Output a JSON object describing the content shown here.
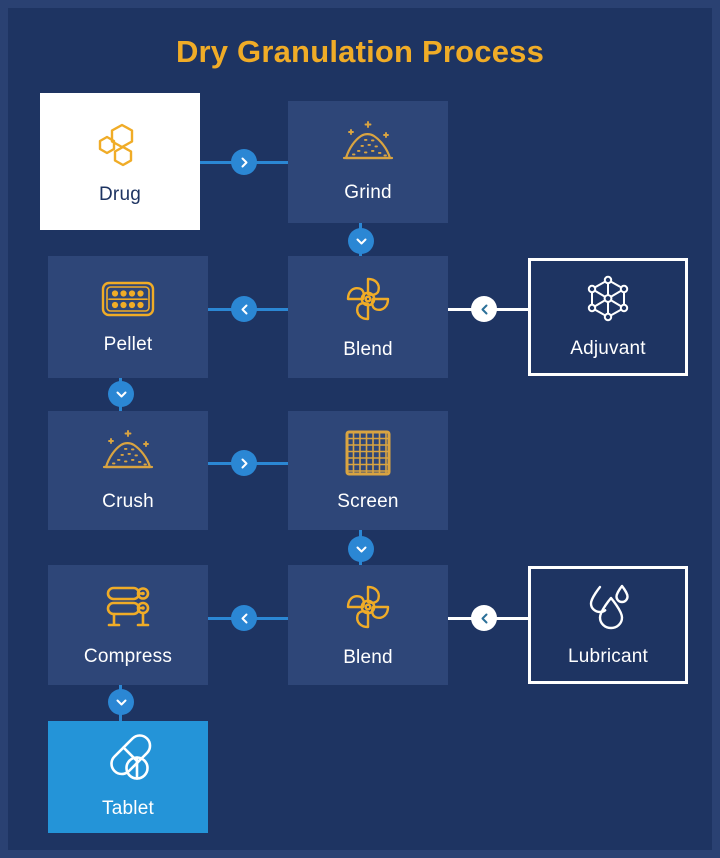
{
  "diagram": {
    "title": "Dry Granulation Process",
    "theme": {
      "page_background": "#1e3462",
      "outer_border": "#2a4172",
      "node_fill": "#2e4678",
      "accent_gold": "#f0ac27",
      "accent_blue": "#2b87d4",
      "tablet_blue": "#2494d8",
      "white": "#ffffff"
    },
    "nodes": [
      {
        "id": "drug",
        "label": "Drug",
        "icon": "molecule-hexagons-icon",
        "style": "white-filled"
      },
      {
        "id": "grind",
        "label": "Grind",
        "icon": "powder-pile-icon",
        "style": "dark-filled"
      },
      {
        "id": "pellet",
        "label": "Pellet",
        "icon": "blister-pack-icon",
        "style": "dark-filled"
      },
      {
        "id": "blend1",
        "label": "Blend",
        "icon": "mixer-pinwheel-icon",
        "style": "dark-filled"
      },
      {
        "id": "adjuvant",
        "label": "Adjuvant",
        "icon": "molecule-network-icon",
        "style": "white-outline"
      },
      {
        "id": "crush",
        "label": "Crush",
        "icon": "powder-pile-icon",
        "style": "dark-filled"
      },
      {
        "id": "screen",
        "label": "Screen",
        "icon": "sieve-mesh-icon",
        "style": "dark-filled"
      },
      {
        "id": "compress",
        "label": "Compress",
        "icon": "roller-compactor-icon",
        "style": "dark-filled"
      },
      {
        "id": "blend2",
        "label": "Blend",
        "icon": "mixer-pinwheel-icon",
        "style": "dark-filled"
      },
      {
        "id": "lubricant",
        "label": "Lubricant",
        "icon": "water-droplets-icon",
        "style": "white-outline"
      },
      {
        "id": "tablet",
        "label": "Tablet",
        "icon": "pills-capsule-icon",
        "style": "accent-filled"
      }
    ],
    "connectors": [
      {
        "id": "drug-to-grind",
        "from": "drug",
        "to": "grind",
        "direction": "right",
        "color": "blue"
      },
      {
        "id": "grind-to-blend1",
        "from": "grind",
        "to": "blend1",
        "direction": "down",
        "color": "blue"
      },
      {
        "id": "blend1-to-pellet",
        "from": "blend1",
        "to": "pellet",
        "direction": "left",
        "color": "blue"
      },
      {
        "id": "adjuvant-to-blend1",
        "from": "adjuvant",
        "to": "blend1",
        "direction": "left",
        "color": "white"
      },
      {
        "id": "pellet-to-crush",
        "from": "pellet",
        "to": "crush",
        "direction": "down",
        "color": "blue"
      },
      {
        "id": "crush-to-screen",
        "from": "crush",
        "to": "screen",
        "direction": "right",
        "color": "blue"
      },
      {
        "id": "screen-to-blend2",
        "from": "screen",
        "to": "blend2",
        "direction": "down",
        "color": "blue"
      },
      {
        "id": "blend2-to-compress",
        "from": "blend2",
        "to": "compress",
        "direction": "left",
        "color": "blue"
      },
      {
        "id": "lubricant-to-blend2",
        "from": "lubricant",
        "to": "blend2",
        "direction": "left",
        "color": "white"
      },
      {
        "id": "compress-to-tablet",
        "from": "compress",
        "to": "tablet",
        "direction": "down",
        "color": "blue"
      }
    ]
  }
}
